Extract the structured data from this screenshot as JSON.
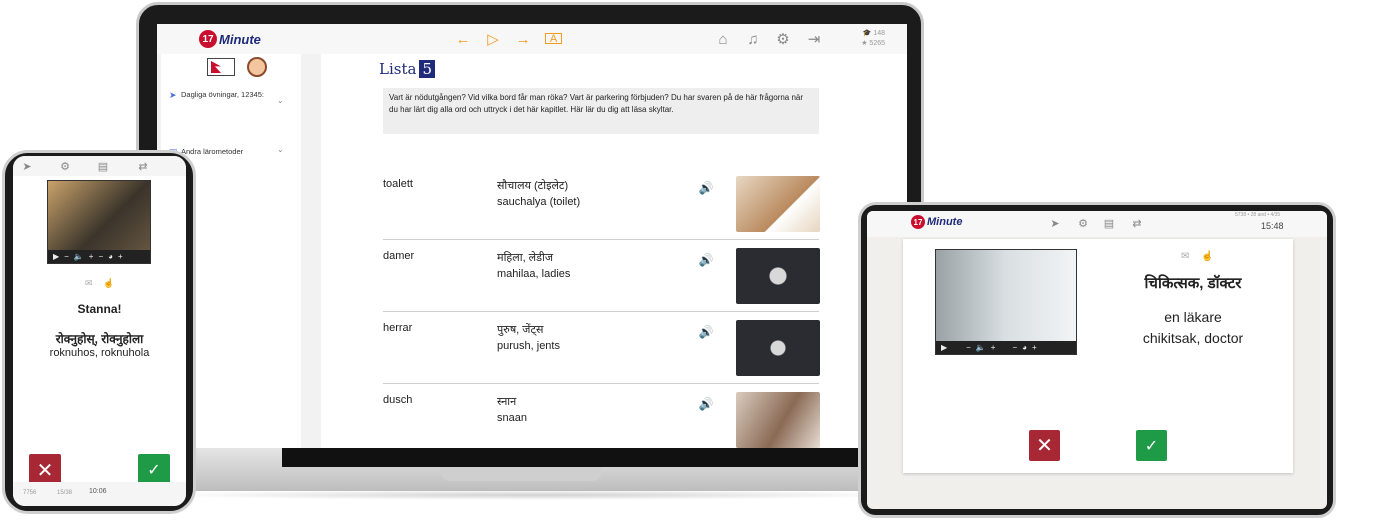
{
  "brand": {
    "badge": "17",
    "name": "Minute",
    "sub": "LANGUAGES"
  },
  "colors": {
    "accent": "#f39c22",
    "brand_blue": "#1f2a7a",
    "wrong": "#a82735",
    "correct": "#1f9a47"
  },
  "laptop": {
    "toolbar_icons": [
      "arrow-left-icon",
      "play-icon",
      "arrow-right-icon",
      "flashcard-icon",
      "home-icon",
      "music-icon",
      "gear-icon",
      "logout-icon"
    ],
    "stats": {
      "top": "148",
      "bottom": "5265"
    },
    "sidebar": {
      "items": [
        {
          "label": "Dagliga övningar, 12345:",
          "icon": "rocket-icon"
        },
        {
          "label": "Andra lärometoder",
          "icon": "book-icon"
        }
      ]
    },
    "main": {
      "title": "Lista",
      "list_number": "5",
      "intro": "Vart är nödutgången? Vid vilka bord får man röka? Vart är parkering förbjuden? Du har svaren på de här frågorna när du har lärt dig alla ord och uttryck i det här kapitlet. Här lär du dig att läsa skyltar.",
      "rows": [
        {
          "swedish": "toalett",
          "native": "सौचालय (टोइलेट)",
          "translit": "sauchalya (toilet)"
        },
        {
          "swedish": "damer",
          "native": "महिला, लेडीज",
          "translit": "mahilaa, ladies"
        },
        {
          "swedish": "herrar",
          "native": "पुरुष, जेंट्स",
          "translit": "purush, jents"
        },
        {
          "swedish": "dusch",
          "native": "स्नान",
          "translit": "snaan"
        }
      ]
    }
  },
  "phone": {
    "prompt": "Stanna!",
    "native": "रोक्नुहोस्, रोक्नुहोला",
    "translit": "roknuhos, roknuhola",
    "status_left": "7756",
    "status_mid": "15/38",
    "time": "10:06"
  },
  "tablet": {
    "stats": "5738 • 28 and • 4/35",
    "time": "15:48",
    "native": "चिकित्सक, डॉक्टर",
    "swedish": "en läkare",
    "translit": "chikitsak, doctor"
  }
}
